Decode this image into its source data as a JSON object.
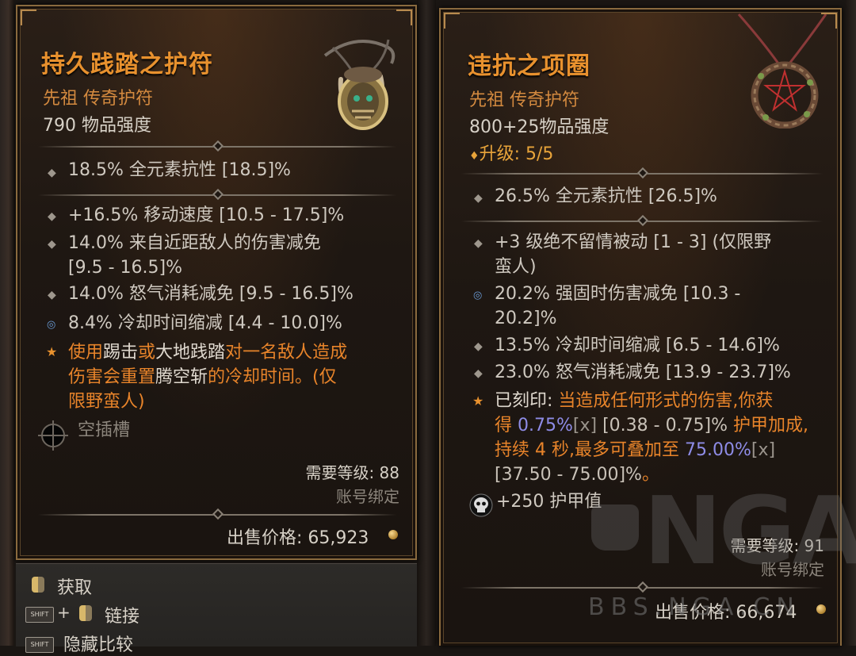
{
  "left_item": {
    "title": "持久践踏之护符",
    "rarity": "先祖 传奇护符",
    "power": "790 物品强度",
    "implicit": "18.5% 全元素抗性 [18.5]%",
    "affixes": [
      {
        "text": "+16.5% 移动速度 [10.5 - 17.5]%"
      },
      {
        "line1": "14.0% 来自近距敌人的伤害减免",
        "line2": "[9.5 - 16.5]%"
      },
      {
        "text": "14.0% 怒气消耗减免 [9.5 - 16.5]%"
      },
      {
        "text": "8.4% 冷却时间缩减 [4.4 - 10.0]%"
      }
    ],
    "legendary": {
      "l1_a": "使用",
      "l1_b": "踢击",
      "l1_c": "或",
      "l1_d": "大地践踏",
      "l1_e": "对一名敌人造成",
      "l2_a": "伤害会重置",
      "l2_b": "腾空斩",
      "l2_c": "的冷却时间。(仅",
      "l3": "限野蛮人)"
    },
    "socket_label": "空插槽",
    "required_level": "需要等级: 88",
    "bound": "账号绑定",
    "sell_label": "出售价格:",
    "sell_value": "65,923",
    "icon": "amulet-icon"
  },
  "right_item": {
    "title": "违抗之项圈",
    "rarity": "先祖 传奇护符",
    "power": "800+25物品强度",
    "upgrade_label": "升级: 5/5",
    "implicit": "26.5% 全元素抗性 [26.5]%",
    "affixes": [
      {
        "line1": "+3 级绝不留情被动 [1 - 3] (仅限野",
        "line2": "蛮人)"
      },
      {
        "line1": "20.2% 强固时伤害减免 [10.3 -",
        "line2": "20.2]%"
      },
      {
        "text": "13.5% 冷却时间缩减 [6.5 - 14.6]%"
      },
      {
        "text": "23.0% 怒气消耗减免 [13.9 - 23.7]%"
      }
    ],
    "legendary": {
      "l1_a": "已刻印: ",
      "l1_b": "当造成任何形式的伤害,你获",
      "l2_a": "得 ",
      "l2_v": "0.75%",
      "l2_x": "[x]",
      "l2_g": " [0.38 - 0.75]% ",
      "l2_b": "护甲加成,",
      "l3_a": "持续 4 秒,最多可叠加至 ",
      "l3_v": "75.00%",
      "l3_x": "[x]",
      "l4_g": "[37.50 - 75.00]%",
      "l4_b": "。"
    },
    "armor": "+250 护甲值",
    "required_level": "需要等级: 91",
    "bound": "账号绑定",
    "sell_label": "出售价格:",
    "sell_value": "66,674",
    "icon": "necklace-icon"
  },
  "bottom_bar": {
    "acquire": "获取",
    "link": "链接",
    "hide_compare": "隐藏比较",
    "shift_key": "SHIFT",
    "plus": "+"
  },
  "watermark": {
    "logo": "NGA",
    "url": "BBS.NGA.CN"
  },
  "colors": {
    "title": "#e8912e",
    "rarity": "#d48a3f",
    "legendary": "#e8842a",
    "value_highlight": "#8e8ce6",
    "border": "#8a6a3e"
  }
}
